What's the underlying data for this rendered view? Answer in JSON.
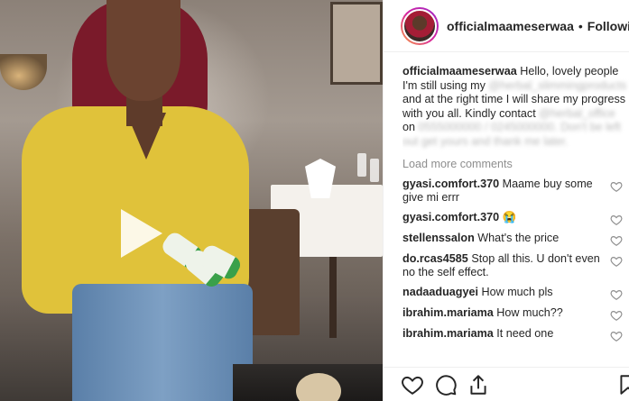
{
  "post": {
    "username": "officialmaameserwaa",
    "separator": "•",
    "follow_status": "Following",
    "caption": {
      "username": "officialmaameserwaa",
      "segments": [
        " Hello, lovely people I'm still using my ",
        " and at the right time I will share my progress with you all. Kindly contact ",
        " on "
      ],
      "blurred": [
        "@herbal_slimmingproducts",
        "@herbal_office",
        "0555000000 / 0245000000. Don't be left out get yours and thank me later."
      ]
    },
    "load_more": "Load more comments",
    "comments": [
      {
        "user": "gyasi.comfort.370",
        "text": " Maame buy some give mi errr"
      },
      {
        "user": "gyasi.comfort.370",
        "text": " 😭"
      },
      {
        "user": "stellenssalon",
        "text": " What's the price"
      },
      {
        "user": "do.rcas4585",
        "text": " Stop all this. U don't even no the self effect."
      },
      {
        "user": "nadaaduagyei",
        "text": " How much pls"
      },
      {
        "user": "ibrahim.mariama",
        "text": " How much??"
      },
      {
        "user": "ibrahim.mariama",
        "text": " It need one"
      }
    ]
  },
  "icons": {
    "play": "play-icon",
    "like": "heart-icon",
    "comment": "comment-icon",
    "share": "share-icon",
    "save": "bookmark-icon"
  },
  "colors": {
    "text": "#262626",
    "muted": "#8e8e8e",
    "border": "#efefef"
  }
}
